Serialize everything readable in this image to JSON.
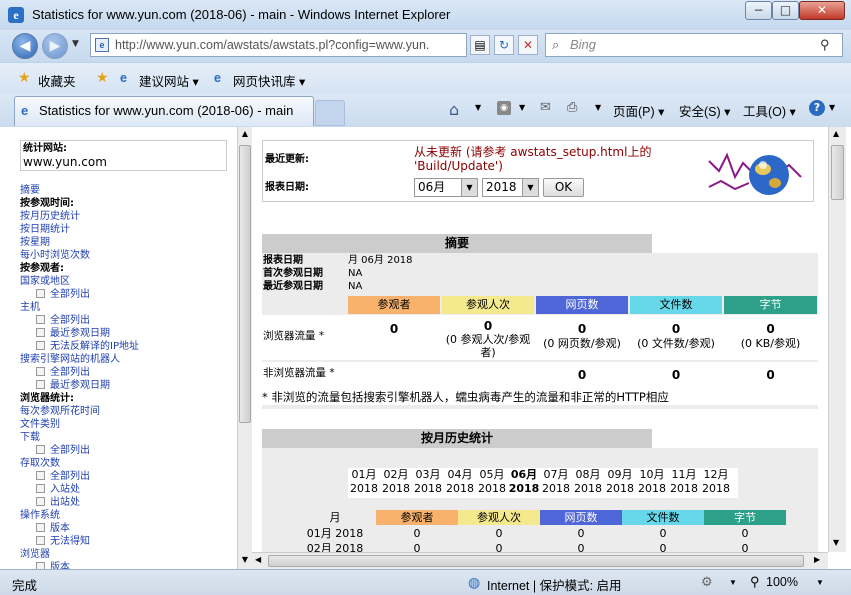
{
  "window": {
    "title": "Statistics for www.yun.com (2018-06) - main - Windows Internet Explorer",
    "min": "−",
    "max": "□",
    "close": "✕"
  },
  "nav": {
    "url": "http://www.yun.com/awstats/awstats.pl?config=www.yun.",
    "search_placeholder": "Bing",
    "back": "◀",
    "forward": "▶"
  },
  "favorites": {
    "label": "收藏夹",
    "items": [
      "建议网站 ▾",
      "网页快讯库 ▾"
    ]
  },
  "tab": {
    "title": "Statistics for www.yun.com (2018-06) - main"
  },
  "commands": {
    "page": "页面(P) ▾",
    "safety": "安全(S) ▾",
    "tools": "工具(O) ▾",
    "help": "?"
  },
  "left": {
    "site_label": "统计网站:",
    "site": "www.yun.com",
    "items": [
      {
        "t": "摘要",
        "k": "link"
      },
      {
        "t": "按参观时间:",
        "k": "head"
      },
      {
        "t": "按月历史统计",
        "k": "link"
      },
      {
        "t": "按日期统计",
        "k": "link"
      },
      {
        "t": "按星期",
        "k": "link"
      },
      {
        "t": "每小时浏览次数",
        "k": "link"
      },
      {
        "t": "按参观者:",
        "k": "head"
      },
      {
        "t": "国家或地区",
        "k": "link"
      },
      {
        "t": "全部列出",
        "k": "sub"
      },
      {
        "t": "主机",
        "k": "link"
      },
      {
        "t": "全部列出",
        "k": "sub"
      },
      {
        "t": "最近参观日期",
        "k": "sub"
      },
      {
        "t": "无法反解译的IP地址",
        "k": "sub"
      },
      {
        "t": "搜索引擎网站的机器人",
        "k": "link"
      },
      {
        "t": "全部列出",
        "k": "sub"
      },
      {
        "t": "最近参观日期",
        "k": "sub"
      },
      {
        "t": "浏览器统计:",
        "k": "head"
      },
      {
        "t": "每次参观所花时间",
        "k": "link"
      },
      {
        "t": "文件类别",
        "k": "link"
      },
      {
        "t": "下载",
        "k": "link"
      },
      {
        "t": "全部列出",
        "k": "sub"
      },
      {
        "t": "存取次数",
        "k": "link"
      },
      {
        "t": "全部列出",
        "k": "sub"
      },
      {
        "t": "入站处",
        "k": "sub"
      },
      {
        "t": "出站处",
        "k": "sub"
      },
      {
        "t": "操作系统",
        "k": "link"
      },
      {
        "t": "版本",
        "k": "sub"
      },
      {
        "t": "无法得知",
        "k": "sub"
      },
      {
        "t": "浏览器",
        "k": "link"
      },
      {
        "t": "版本",
        "k": "sub"
      }
    ]
  },
  "main": {
    "last_update_label": "最近更新:",
    "last_update_value": "从未更新 (请参考 awstats_setup.html上的 'Build/Update')",
    "report_date_label": "报表日期:",
    "month": "06月",
    "year": "2018",
    "ok": "OK",
    "summary": {
      "title": "摘要",
      "lines": [
        [
          "报表日期",
          "月 06月 2018"
        ],
        [
          "首次参观日期",
          "NA"
        ],
        [
          "最近参观日期",
          "NA"
        ]
      ],
      "cols": [
        {
          "l": "参观者",
          "c": "#f9b26b"
        },
        {
          "l": "参观人次",
          "c": "#f5e98d"
        },
        {
          "l": "网页数",
          "c": "#4f66d8"
        },
        {
          "l": "文件数",
          "c": "#66d8ea"
        },
        {
          "l": "字节",
          "c": "#2da08a"
        }
      ],
      "rows": [
        {
          "label": "浏览器流量 *",
          "cells": [
            [
              "0",
              ""
            ],
            [
              "0",
              "(0 参观人次/参观者)"
            ],
            [
              "0",
              "(0 网页数/参观)"
            ],
            [
              "0",
              "(0 文件数/参观)"
            ],
            [
              "0",
              "(0 KB/参观)"
            ]
          ]
        },
        {
          "label": "非浏览器流量 *",
          "cells": [
            [
              "",
              ""
            ],
            [
              "",
              ""
            ],
            [
              "0",
              ""
            ],
            [
              "0",
              ""
            ],
            [
              "0",
              ""
            ]
          ]
        }
      ],
      "footnote": "* 非浏览的流量包括搜索引擎机器人，蠕虫病毒产生的流量和非正常的HTTP相应"
    },
    "history": {
      "title": "按月历史统计",
      "months": [
        [
          "01月",
          "2018"
        ],
        [
          "02月",
          "2018"
        ],
        [
          "03月",
          "2018"
        ],
        [
          "04月",
          "2018"
        ],
        [
          "05月",
          "2018"
        ],
        [
          "06月",
          "2018"
        ],
        [
          "07月",
          "2018"
        ],
        [
          "08月",
          "2018"
        ],
        [
          "09月",
          "2018"
        ],
        [
          "10月",
          "2018"
        ],
        [
          "11月",
          "2018"
        ],
        [
          "12月",
          "2018"
        ]
      ],
      "bold_index": 5,
      "cols": [
        "月",
        "参观者",
        "参观人次",
        "网页数",
        "文件数",
        "字节"
      ],
      "rows": [
        [
          "01月 2018",
          "0",
          "0",
          "0",
          "0",
          "0"
        ],
        [
          "02月 2018",
          "0",
          "0",
          "0",
          "0",
          "0"
        ]
      ]
    }
  },
  "status": {
    "left": "完成",
    "zone": "Internet | 保护模式: 启用",
    "zoom": "100%"
  }
}
